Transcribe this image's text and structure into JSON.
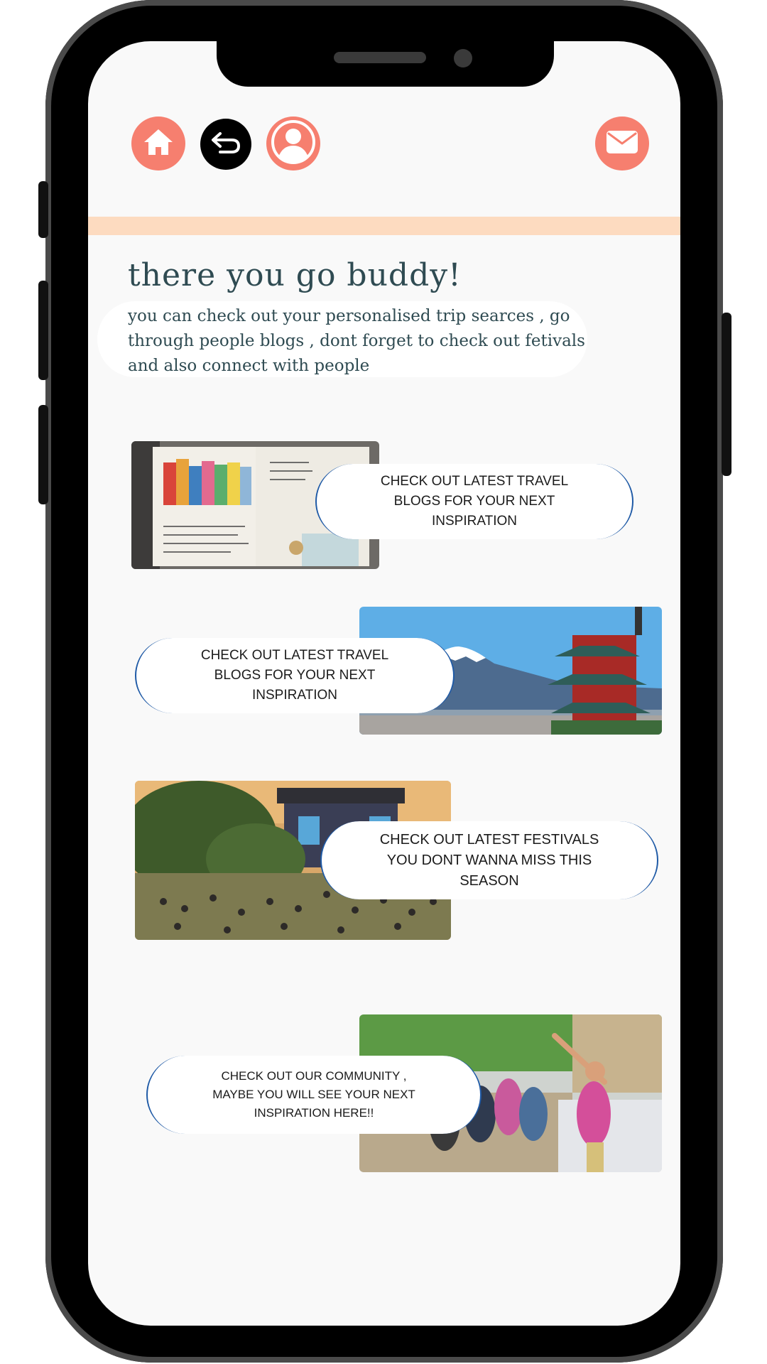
{
  "nav": {
    "home_icon": "home-icon",
    "back_icon": "back-arrow-icon",
    "profile_icon": "user-profile-icon",
    "mail_icon": "mail-icon"
  },
  "heading": {
    "title": "there you go buddy!",
    "subtitle": "you can check out your personalised trip searces , go through people blogs , dont forget to check out fetivals and also connect with people"
  },
  "cards": [
    {
      "label": "CHECK OUT LATEST TRAVEL BLOGS FOR YOUR NEXT INSPIRATION"
    },
    {
      "label": "CHECK OUT LATEST TRAVEL BLOGS FOR YOUR NEXT INSPIRATION"
    },
    {
      "label": "CHECK OUT LATEST FESTIVALS YOU DONT WANNA MISS THIS SEASON"
    },
    {
      "label": "CHECK OUT OUR  COMMUNITY , MAYBE YOU WILL SEE YOUR NEXT INSPIRATION HERE!!"
    }
  ],
  "colors": {
    "accent": "#f67f6f",
    "band": "#fddbc0",
    "text": "#2f4b52",
    "pill_border": "#1f5aa6"
  }
}
